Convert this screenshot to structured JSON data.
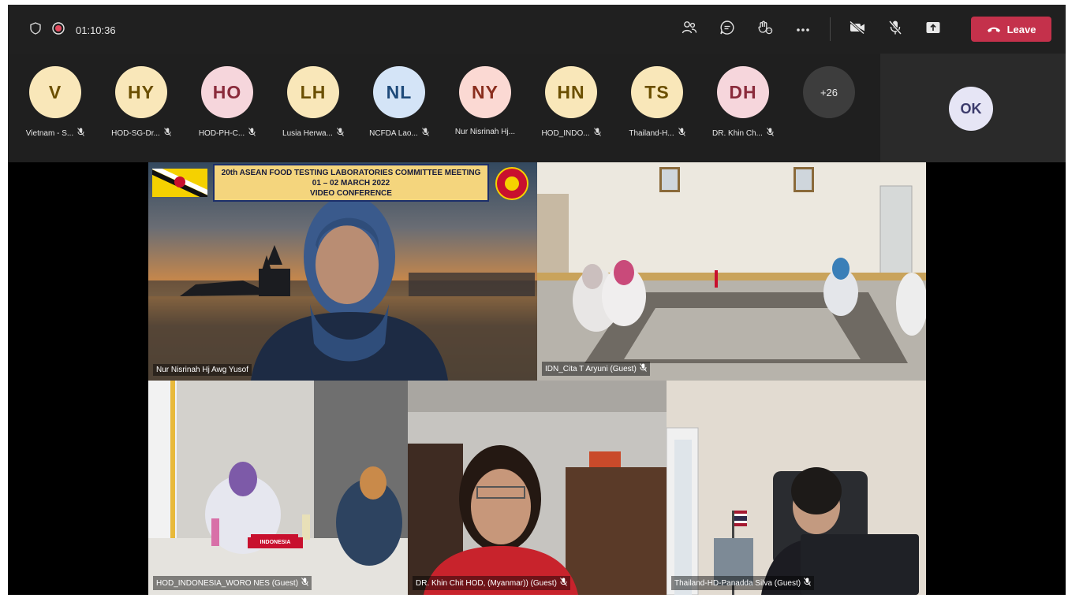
{
  "call": {
    "timer": "01:10:36",
    "leave_label": "Leave"
  },
  "participants": [
    {
      "initials": "V",
      "name": "Vietnam - S...",
      "bg": "#f9e7b9",
      "fg": "#6b4f00"
    },
    {
      "initials": "HY",
      "name": "HOD-SG-Dr...",
      "bg": "#f9e7b9",
      "fg": "#6b4f00"
    },
    {
      "initials": "HO",
      "name": "HOD-PH-C...",
      "bg": "#f6d6dc",
      "fg": "#8a2b3b"
    },
    {
      "initials": "LH",
      "name": "Lusia Herwa...",
      "bg": "#f9e7b9",
      "fg": "#6b4f00"
    },
    {
      "initials": "NL",
      "name": "NCFDA Lao...",
      "bg": "#d4e4f7",
      "fg": "#1e4a7a"
    },
    {
      "initials": "NY",
      "name": "Nur Nisrinah Hj...",
      "bg": "#fbd9d3",
      "fg": "#8a2e1e"
    },
    {
      "initials": "HN",
      "name": "HOD_INDO...",
      "bg": "#f9e7b9",
      "fg": "#6b4f00"
    },
    {
      "initials": "TS",
      "name": "Thailand-H...",
      "bg": "#f9e7b9",
      "fg": "#6b4f00"
    },
    {
      "initials": "DH",
      "name": "DR. Khin Ch...",
      "bg": "#f6d6dc",
      "fg": "#8a2b3b"
    }
  ],
  "overflow_count": "+26",
  "self_initials": "OK",
  "videos": {
    "t1": {
      "name": "Nur Nisrinah Hj Awg Yusof"
    },
    "t2": {
      "name": "IDN_Cita T Aryuni (Guest)"
    },
    "t3": {
      "name": "HOD_INDONESIA_WORO NES (Guest)"
    },
    "t4": {
      "name": "DR. Khin Chit  HOD, (Myanmar)) (Guest)"
    },
    "t5": {
      "name": "Thailand-HD-Panadda Silva (Guest)"
    }
  },
  "banner": {
    "line1": "20th ASEAN FOOD TESTING LABORATORIES COMMITTEE MEETING",
    "line2": "01 – 02 MARCH 2022",
    "line3": "VIDEO CONFERENCE"
  },
  "tent_card": "INDONESIA",
  "icons": [
    "shield-icon",
    "record-icon",
    "people-icon",
    "chat-icon",
    "raise-hand-icon",
    "more-icon",
    "camera-off-icon",
    "mic-off-icon",
    "share-icon",
    "phone-icon"
  ],
  "colors": {
    "leave": "#c4314b",
    "topbar": "#202020",
    "strip": "#1f1f1f"
  }
}
